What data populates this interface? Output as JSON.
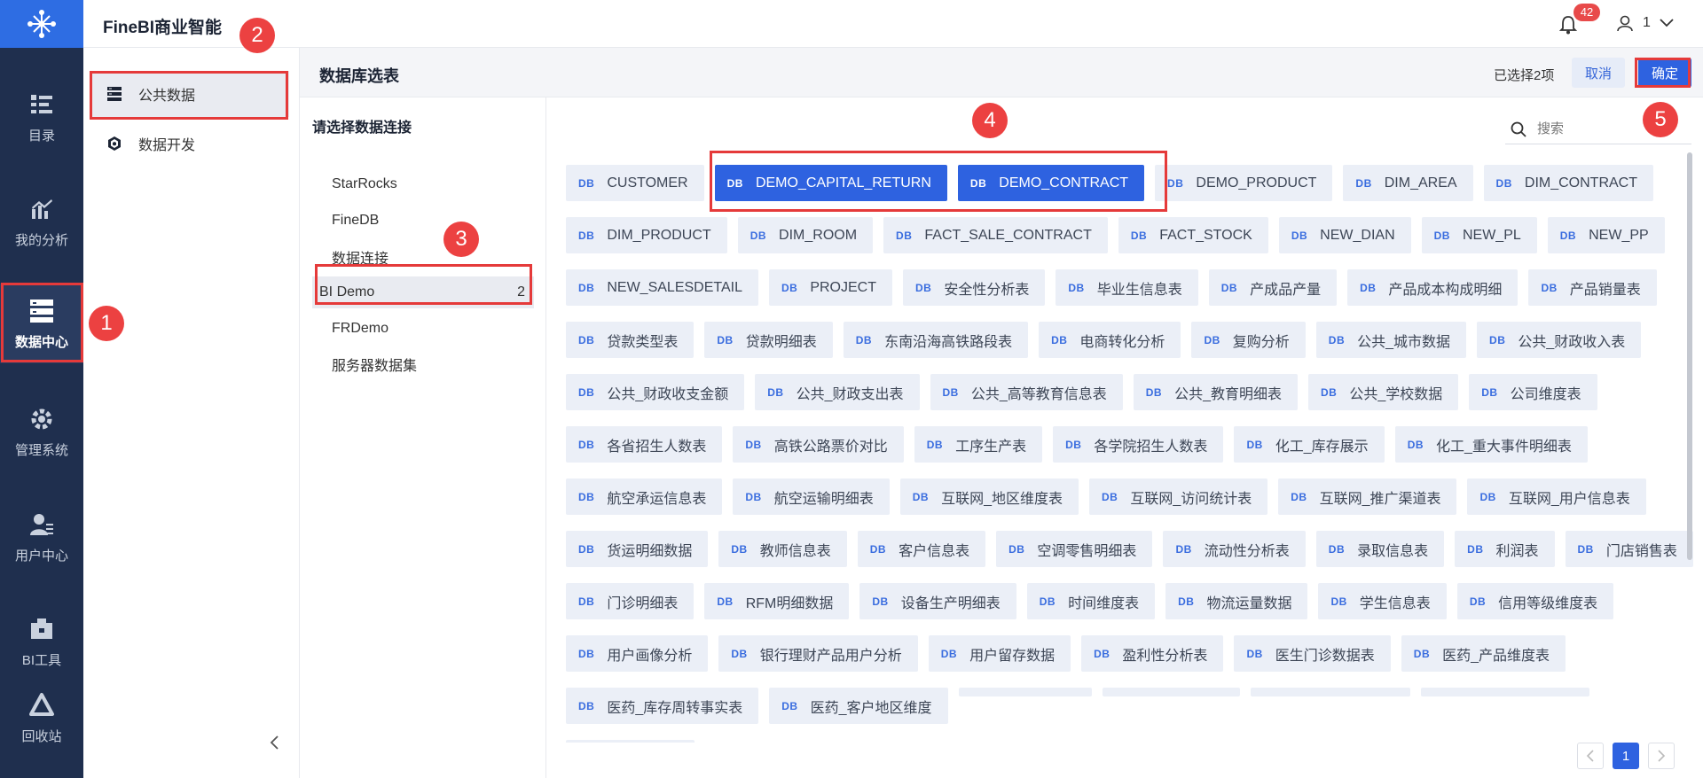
{
  "app": {
    "brand": "FineBI商业智能",
    "notifications": "42",
    "user": "1"
  },
  "rail": [
    {
      "label": "目录",
      "icon": "catalog-icon"
    },
    {
      "label": "我的分析",
      "icon": "analysis-icon"
    },
    {
      "label": "数据中心",
      "icon": "data-center-icon"
    },
    {
      "label": "管理系统",
      "icon": "gear-icon"
    },
    {
      "label": "用户中心",
      "icon": "user-center-icon"
    },
    {
      "label": "BI工具",
      "icon": "toolbox-icon"
    },
    {
      "label": "回收站",
      "icon": "recycle-icon"
    }
  ],
  "subnav": [
    {
      "label": "公共数据",
      "icon": "database-icon"
    },
    {
      "label": "数据开发",
      "icon": "cube-icon"
    }
  ],
  "header": {
    "title": "数据库选表",
    "selected_text": "已选择2项",
    "cancel": "取消",
    "confirm": "确定"
  },
  "connections": {
    "heading": "请选择数据连接",
    "items": [
      {
        "label": "StarRocks",
        "count": ""
      },
      {
        "label": "FineDB",
        "count": ""
      },
      {
        "label": "数据连接",
        "count": ""
      },
      {
        "label": "BI Demo",
        "count": "2"
      },
      {
        "label": "FRDemo",
        "count": ""
      },
      {
        "label": "服务器数据集",
        "count": ""
      }
    ]
  },
  "search": {
    "placeholder": "搜索"
  },
  "tables": {
    "db_tag": "DB",
    "items": [
      "CUSTOMER",
      "DEMO_CAPITAL_RETURN",
      "DEMO_CONTRACT",
      "DEMO_PRODUCT",
      "DIM_AREA",
      "DIM_CONTRACT",
      "DIM_PRODUCT",
      "DIM_ROOM",
      "FACT_SALE_CONTRACT",
      "FACT_STOCK",
      "NEW_DIAN",
      "NEW_PL",
      "NEW_PP",
      "NEW_SALESDETAIL",
      "PROJECT",
      "安全性分析表",
      "毕业生信息表",
      "产成品产量",
      "产品成本构成明细",
      "产品销量表",
      "贷款类型表",
      "贷款明细表",
      "东南沿海高铁路段表",
      "电商转化分析",
      "复购分析",
      "公共_城市数据",
      "公共_财政收入表",
      "公共_财政收支金额",
      "公共_财政支出表",
      "公共_高等教育信息表",
      "公共_教育明细表",
      "公共_学校数据",
      "公司维度表",
      "各省招生人数表",
      "高铁公路票价对比",
      "工序生产表",
      "各学院招生人数表",
      "化工_库存展示",
      "化工_重大事件明细表",
      "航空承运信息表",
      "航空运输明细表",
      "互联网_地区维度表",
      "互联网_访问统计表",
      "互联网_推广渠道表",
      "互联网_用户信息表",
      "货运明细数据",
      "教师信息表",
      "客户信息表",
      "空调零售明细表",
      "流动性分析表",
      "录取信息表",
      "利润表",
      "门店销售表",
      "门诊明细表",
      "RFM明细数据",
      "设备生产明细表",
      "时间维度表",
      "物流运量数据",
      "学生信息表",
      "信用等级维度表",
      "用户画像分析",
      "银行理财产品用户分析",
      "用户留存数据",
      "盈利性分析表",
      "医生门诊数据表",
      "医药_产品维度表",
      "医药_库存周转事实表",
      "医药_客户地区维度"
    ],
    "selected": [
      "DEMO_CAPITAL_RETURN",
      "DEMO_CONTRACT"
    ]
  },
  "pagination": {
    "current": "1"
  },
  "annotations": [
    "1",
    "2",
    "3",
    "4",
    "5"
  ]
}
